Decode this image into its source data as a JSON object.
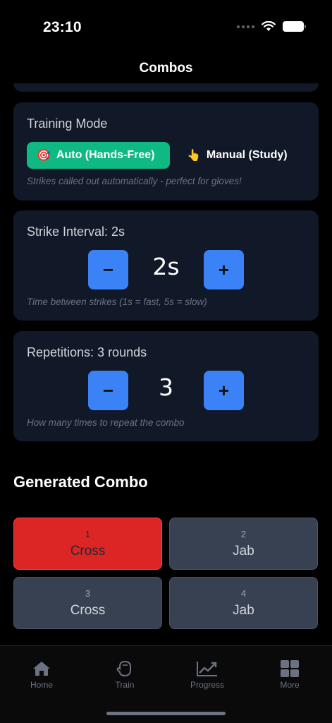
{
  "status_bar": {
    "time": "23:10"
  },
  "nav": {
    "title": "Combos"
  },
  "training_mode": {
    "title": "Training Mode",
    "auto_emoji": "🎯",
    "auto_label": "Auto (Hands-Free)",
    "manual_emoji": "👆",
    "manual_label": "Manual (Study)",
    "hint": "Strikes called out automatically - perfect for gloves!"
  },
  "strike_interval": {
    "title": "Strike Interval: 2s",
    "minus": "−",
    "value": "2s",
    "plus": "+",
    "hint": "Time between strikes (1s = fast, 5s = slow)"
  },
  "repetitions": {
    "title": "Repetitions: 3 rounds",
    "minus": "−",
    "value": "3",
    "plus": "+",
    "hint": "How many times to repeat the combo"
  },
  "generated_combo": {
    "title": "Generated Combo",
    "items": [
      {
        "number": "1",
        "name": "Cross",
        "active": true
      },
      {
        "number": "2",
        "name": "Jab",
        "active": false
      },
      {
        "number": "3",
        "name": "Cross",
        "active": false
      },
      {
        "number": "4",
        "name": "Jab",
        "active": false
      }
    ]
  },
  "tabs": [
    {
      "label": "Home",
      "icon": "home-icon"
    },
    {
      "label": "Train",
      "icon": "glove-icon"
    },
    {
      "label": "Progress",
      "icon": "trending-up-icon"
    },
    {
      "label": "More",
      "icon": "grid-icon"
    }
  ],
  "colors": {
    "accent_green": "#10b981",
    "accent_blue": "#3b82f6",
    "active_red": "#dc2626",
    "card_bg": "#111827"
  }
}
